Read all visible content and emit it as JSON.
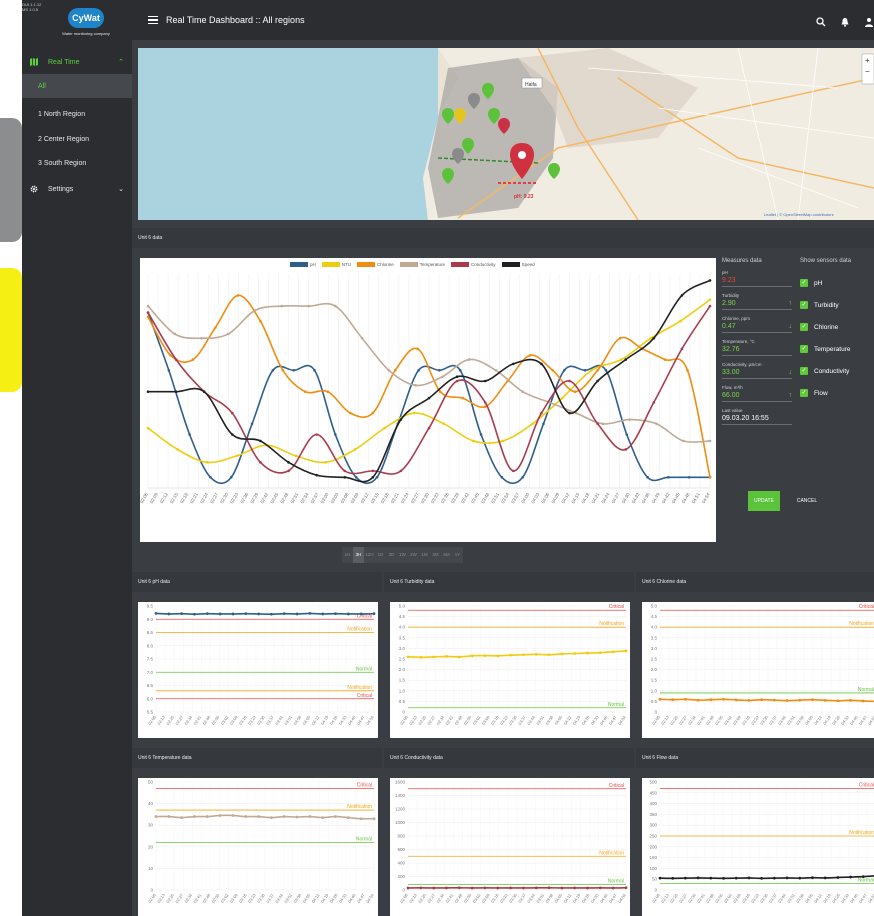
{
  "version_lines": [
    "GUI 1.1.12",
    "MS 1.0.5"
  ],
  "brand": {
    "name": "CyWat",
    "tagline": "Water monitoring company"
  },
  "sidebar": {
    "real_time": "Real Time",
    "items": [
      "All",
      "1 North Region",
      "2 Center Region",
      "3 South Region"
    ],
    "settings": "Settings"
  },
  "header": {
    "title": "Real Time Dashboard :: All regions"
  },
  "map": {
    "city_label": "Haifa",
    "marker_label": "pH: 9.23",
    "attribution": "Leaflet | © OpenStreetMap contributors"
  },
  "unit_section": {
    "title": "Unit 6 data"
  },
  "colors": {
    "ph": "#2e5f8c",
    "ntu": "#f0cc10",
    "chlorine": "#f08c10",
    "temperature": "#c0aa96",
    "conductivity": "#a83c4e",
    "speed": "#202020",
    "critical": "#e84a4a",
    "notification": "#f2a51a",
    "normal": "#66c43c"
  },
  "measures": {
    "title": "Measures data",
    "items": [
      {
        "label": "pH",
        "value": "9.23",
        "trend": ""
      },
      {
        "label": "Turbidity",
        "value": "2.90",
        "trend": "↑"
      },
      {
        "label": "Chlorine, ppm",
        "value": "0.47",
        "trend": "↓"
      },
      {
        "label": "Temperature, °C",
        "value": "32.76",
        "trend": ""
      },
      {
        "label": "Conductivity, µS/cm",
        "value": "33.00",
        "trend": "↓"
      },
      {
        "label": "Flow, m³/h",
        "value": "66.00",
        "trend": "↑"
      },
      {
        "label": "Last value",
        "value": "09.03.20 16:55",
        "trend": ""
      }
    ]
  },
  "sensors": {
    "title": "Show sensors data",
    "items": [
      "pH",
      "Turbidity",
      "Chlorine",
      "Temperature",
      "Conductivity",
      "Flow"
    ]
  },
  "buttons": {
    "update": "UPDATE",
    "cancel": "CANCEL"
  },
  "time_ranges": {
    "items": [
      "1H",
      "3H",
      "12H",
      "1D",
      "3D",
      "1W",
      "2W",
      "1M",
      "3M",
      "6M",
      "1Y"
    ],
    "active": "3H"
  },
  "chart_data": [
    {
      "type": "line",
      "legend": [
        "pH",
        "NTU",
        "Chlorine",
        "Temperature",
        "Conductivity",
        "Speed"
      ],
      "x": [
        "02:06",
        "02:09",
        "02:12",
        "02:15",
        "02:18",
        "02:21",
        "02:24",
        "02:27",
        "02:30",
        "02:33",
        "02:36",
        "02:39",
        "02:42",
        "02:45",
        "02:48",
        "02:51",
        "02:54",
        "02:57",
        "03:00",
        "03:03",
        "03:06",
        "03:09",
        "03:12",
        "03:15",
        "03:18",
        "03:21",
        "03:24",
        "03:27",
        "03:30",
        "03:33",
        "03:36",
        "03:39",
        "03:42",
        "03:45",
        "03:48",
        "03:51",
        "03:54",
        "03:57",
        "04:00",
        "04:03",
        "04:06",
        "04:09",
        "04:12",
        "04:15",
        "04:18",
        "04:21",
        "04:24",
        "04:27",
        "04:30",
        "04:33",
        "04:36",
        "04:39",
        "04:42",
        "04:45",
        "04:48",
        "04:51",
        "04:54"
      ],
      "series": [
        {
          "name": "pH",
          "values": [
            0.82,
            0.55,
            0.25,
            0.05,
            0.05,
            0.3,
            0.55,
            0.55,
            0.55,
            0.25,
            0.05,
            0.05,
            0.3,
            0.55,
            0.55,
            0.55,
            0.25,
            0.05,
            0.05,
            0.3,
            0.55,
            0.55,
            0.55,
            0.25,
            0.05,
            0.05,
            0.05,
            0.05
          ]
        },
        {
          "name": "NTU",
          "values": [
            0.28,
            0.18,
            0.12,
            0.15,
            0.2,
            0.15,
            0.12,
            0.18,
            0.28,
            0.35,
            0.3,
            0.22,
            0.22,
            0.3,
            0.42,
            0.55,
            0.6,
            0.7,
            0.78,
            0.88
          ]
        },
        {
          "name": "Chlorine",
          "values": [
            0.8,
            0.62,
            0.6,
            0.75,
            0.9,
            0.78,
            0.55,
            0.45,
            0.45,
            0.35,
            0.35,
            0.55,
            0.65,
            0.45,
            0.42,
            0.38,
            0.5,
            0.62,
            0.55,
            0.45,
            0.55,
            0.7,
            0.65,
            0.6,
            0.55,
            0.05
          ]
        },
        {
          "name": "Temperature",
          "values": [
            0.85,
            0.72,
            0.7,
            0.72,
            0.83,
            0.85,
            0.85,
            0.85,
            0.7,
            0.55,
            0.48,
            0.52,
            0.6,
            0.55,
            0.45,
            0.4,
            0.35,
            0.3,
            0.32,
            0.3,
            0.22,
            0.22
          ]
        },
        {
          "name": "Conductivity",
          "values": [
            0.82,
            0.6,
            0.45,
            0.35,
            0.12,
            0.08,
            0.25,
            0.08,
            0.08,
            0.08,
            0.28,
            0.5,
            0.4,
            0.08,
            0.35,
            0.5,
            0.3,
            0.18,
            0.4,
            0.65,
            0.85
          ]
        },
        {
          "name": "Speed",
          "values": [
            0.45,
            0.45,
            0.45,
            0.25,
            0.22,
            0.12,
            0.06,
            0.05,
            0.05,
            0.32,
            0.42,
            0.52,
            0.5,
            0.58,
            0.58,
            0.35,
            0.5,
            0.6,
            0.7,
            0.9,
            0.97
          ]
        }
      ],
      "ylim": [
        0,
        1
      ]
    },
    {
      "type": "line",
      "title": "Unit 6 pH data",
      "ylim": [
        5.5,
        9.5
      ],
      "ticks": [
        "9.5",
        "9.0",
        "8.5",
        "8.0",
        "7.5",
        "7.0",
        "6.5",
        "6.0",
        "5.5"
      ],
      "series": [
        {
          "name": "pH",
          "values": [
            9.22,
            9.2,
            9.21,
            9.19,
            9.21,
            9.2,
            9.2,
            9.21,
            9.2,
            9.19,
            9.21,
            9.2,
            9.22,
            9.2,
            9.21,
            9.2,
            9.2,
            9.21
          ]
        }
      ],
      "thresholds": [
        {
          "label": "Critical",
          "y": 9.0,
          "kind": "critical"
        },
        {
          "label": "Notification",
          "y": 8.5,
          "kind": "notification"
        },
        {
          "label": "Normal",
          "y": 7.0,
          "kind": "normal"
        },
        {
          "label": "Notification",
          "y": 6.3,
          "kind": "notification"
        },
        {
          "label": "Critical",
          "y": 6.0,
          "kind": "critical"
        }
      ]
    },
    {
      "type": "line",
      "title": "Unit 6 Turbidity data",
      "ylim": [
        0,
        5
      ],
      "ticks": [
        "5.0",
        "4.5",
        "4.0",
        "3.5",
        "3.0",
        "2.5",
        "2.0",
        "1.5",
        "1.0",
        "0.5",
        "0"
      ],
      "series": [
        {
          "name": "Turbidity",
          "values": [
            2.6,
            2.58,
            2.6,
            2.62,
            2.6,
            2.65,
            2.66,
            2.65,
            2.68,
            2.7,
            2.72,
            2.7,
            2.74,
            2.76,
            2.78,
            2.8,
            2.84,
            2.88
          ]
        }
      ],
      "thresholds": [
        {
          "label": "Critical",
          "y": 4.8,
          "kind": "critical"
        },
        {
          "label": "Notification",
          "y": 4.0,
          "kind": "notification"
        },
        {
          "label": "Normal",
          "y": 0.2,
          "kind": "normal"
        }
      ]
    },
    {
      "type": "line",
      "title": "Unit 6 Chlorine data",
      "ylim": [
        0,
        5
      ],
      "ticks": [
        "5.0",
        "4.5",
        "4.0",
        "3.5",
        "3.0",
        "2.5",
        "2.0",
        "1.5",
        "1.0",
        "0.5",
        "0"
      ],
      "series": [
        {
          "name": "Chlorine",
          "values": [
            0.6,
            0.58,
            0.6,
            0.56,
            0.58,
            0.6,
            0.57,
            0.55,
            0.58,
            0.56,
            0.54,
            0.56,
            0.58,
            0.55,
            0.53,
            0.55,
            0.52,
            0.5
          ]
        }
      ],
      "thresholds": [
        {
          "label": "Critical",
          "y": 4.8,
          "kind": "critical"
        },
        {
          "label": "Notification",
          "y": 4.0,
          "kind": "notification"
        },
        {
          "label": "Normal",
          "y": 0.9,
          "kind": "normal"
        }
      ]
    },
    {
      "type": "line",
      "title": "Unit 6 Temperature data",
      "ylim": [
        0,
        50
      ],
      "ticks": [
        "50",
        "40",
        "30",
        "20",
        "10",
        "0"
      ],
      "series": [
        {
          "name": "Temperature",
          "values": [
            34,
            34,
            33.5,
            34,
            34,
            34.5,
            34.5,
            34,
            34,
            33.5,
            34,
            33.8,
            34,
            33.5,
            34,
            33.5,
            33,
            33
          ]
        }
      ],
      "thresholds": [
        {
          "label": "Critical",
          "y": 47,
          "kind": "critical"
        },
        {
          "label": "Notification",
          "y": 37,
          "kind": "notification"
        },
        {
          "label": "Normal",
          "y": 22,
          "kind": "normal"
        }
      ]
    },
    {
      "type": "line",
      "title": "Unit 6 Conductivity data",
      "ylim": [
        0,
        1600
      ],
      "ticks": [
        "1600",
        "1400",
        "1200",
        "1000",
        "800",
        "600",
        "400",
        "200",
        "0"
      ],
      "series": [
        {
          "name": "Conductivity",
          "values": [
            30,
            32,
            30,
            31,
            33,
            30,
            32,
            30,
            31,
            30,
            32,
            33,
            30,
            31,
            30,
            32,
            30,
            33
          ]
        }
      ],
      "thresholds": [
        {
          "label": "Critical",
          "y": 1500,
          "kind": "critical"
        },
        {
          "label": "Notification",
          "y": 500,
          "kind": "notification"
        },
        {
          "label": "Normal",
          "y": 80,
          "kind": "normal"
        }
      ]
    },
    {
      "type": "line",
      "title": "Unit 6 Flow data",
      "ylim": [
        0,
        500
      ],
      "ticks": [
        "500",
        "450",
        "400",
        "350",
        "300",
        "250",
        "200",
        "150",
        "100",
        "50",
        "0"
      ],
      "series": [
        {
          "name": "Flow",
          "values": [
            55,
            54,
            55,
            56,
            55,
            54,
            55,
            56,
            54,
            55,
            56,
            55,
            57,
            56,
            58,
            60,
            62,
            66
          ]
        }
      ],
      "thresholds": [
        {
          "label": "Critical",
          "y": 470,
          "kind": "critical"
        },
        {
          "label": "Notification",
          "y": 250,
          "kind": "notification"
        },
        {
          "label": "Normal",
          "y": 30,
          "kind": "normal"
        }
      ]
    }
  ]
}
